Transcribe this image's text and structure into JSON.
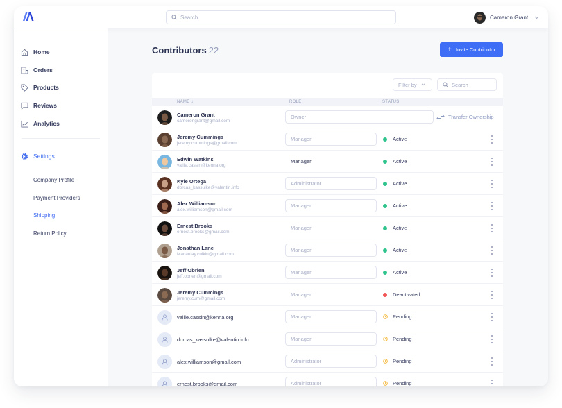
{
  "app": {
    "logo": "brand-logo",
    "search_placeholder": "Search",
    "user_name": "Cameron Grant",
    "accent_color": "#3d6ef5"
  },
  "sidebar": {
    "items": [
      {
        "label": "Home",
        "icon": "home-icon"
      },
      {
        "label": "Orders",
        "icon": "orders-icon"
      },
      {
        "label": "Products",
        "icon": "tag-icon"
      },
      {
        "label": "Reviews",
        "icon": "chat-icon"
      },
      {
        "label": "Analytics",
        "icon": "chart-icon"
      }
    ],
    "settings": {
      "label": "Settings",
      "icon": "gear-icon"
    },
    "sub_items": [
      {
        "label": "Company Profile"
      },
      {
        "label": "Payment Providers"
      },
      {
        "label": "Shipping",
        "active": true
      },
      {
        "label": "Return Policy"
      }
    ]
  },
  "main": {
    "title": "Contributors",
    "count": "22",
    "invite_label": "Invite Contributor",
    "filter_label": "Filter by",
    "search_placeholder": "Search",
    "columns": {
      "name": "NAME",
      "role": "ROLE",
      "status": "STATUS"
    },
    "transfer_label": "Transfer Ownership",
    "status_colors": {
      "Active": "#2fc48d",
      "Deactivated": "#f25757",
      "Pending": "#f5b73b"
    },
    "rows": [
      {
        "name": "Cameron Grant",
        "email": "camerongrant@gmail.com",
        "role": "Owner",
        "status": ""
      },
      {
        "name": "Jeremy Cummings",
        "email": "jeremy.cummings@gmail.com",
        "role": "Manager",
        "status": "Active"
      },
      {
        "name": "Edwin Watkins",
        "email": "vallie.cassin@kenna.org",
        "role": "Manager",
        "status": "Active"
      },
      {
        "name": "Kyle Ortega",
        "email": "dorcas_kassulke@valentin.info",
        "role": "Administrator",
        "status": "Active"
      },
      {
        "name": "Alex Williamson",
        "email": "alex.williamson@gmail.com",
        "role": "Manager",
        "status": "Active"
      },
      {
        "name": "Ernest Brooks",
        "email": "ernest.brooks@gmail.com",
        "role": "Manager",
        "status": "Active"
      },
      {
        "name": "Jonathan Lane",
        "email": "Macaulay.culkin@gmail.com",
        "role": "Manager",
        "status": "Active"
      },
      {
        "name": "Jeff Obrien",
        "email": "jeff.obrien@gmail.com",
        "role": "Manager",
        "status": "Active"
      },
      {
        "name": "Jeremy Cummings",
        "email": "jeremy.cum@gmail.com",
        "role": "Manager",
        "status": "Deactivated"
      },
      {
        "name": "",
        "email": "vallie.cassin@kenna.org",
        "role": "Manager",
        "status": "Pending"
      },
      {
        "name": "",
        "email": "dorcas_kassulke@valentin.info",
        "role": "Manager",
        "status": "Pending"
      },
      {
        "name": "",
        "email": "alex.williamson@gmail.com",
        "role": "Administrator",
        "status": "Pending"
      },
      {
        "name": "",
        "email": "ernest.brooks@gmail.com",
        "role": "Administrator",
        "status": "Pending"
      }
    ]
  }
}
